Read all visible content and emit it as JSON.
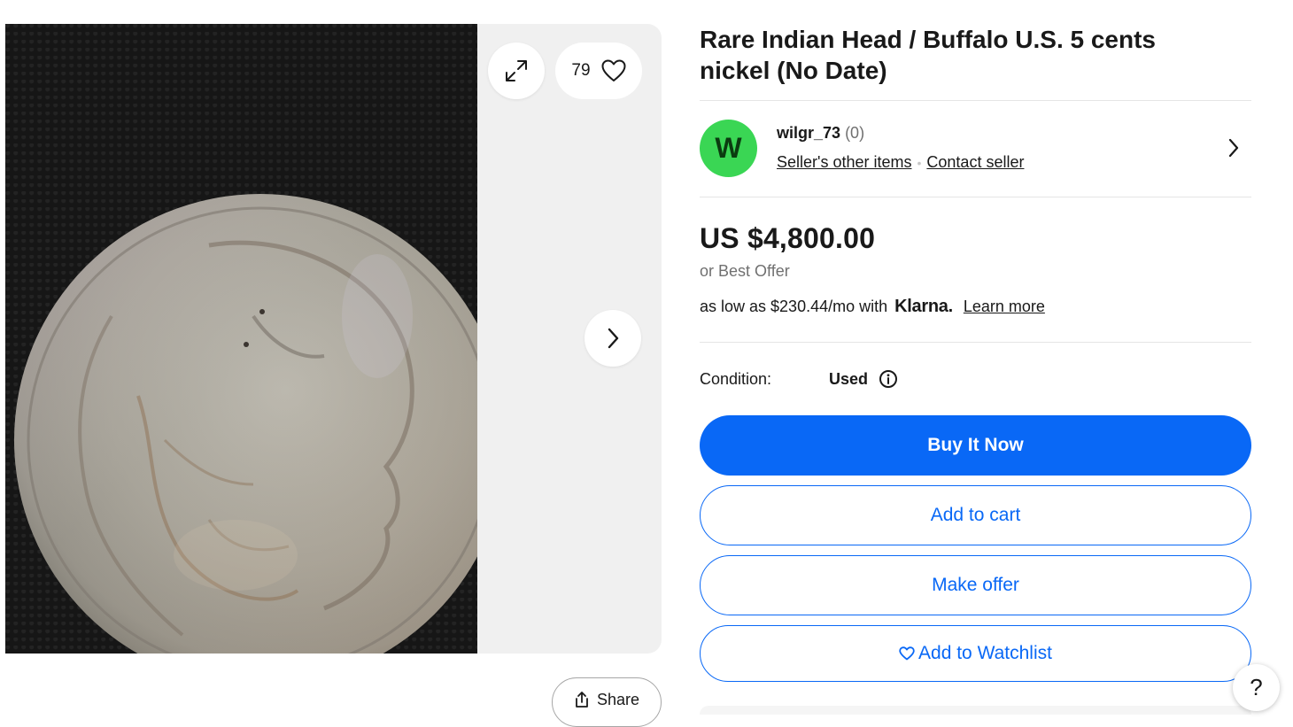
{
  "gallery": {
    "watch_count": "79",
    "share_label": "Share",
    "image_alt": "Buffalo nickel coin photo"
  },
  "listing": {
    "title": "Rare Indian Head / Buffalo U.S. 5 cents nickel (No Date)"
  },
  "seller": {
    "avatar_letter": "W",
    "name": "wilgr_73",
    "score": "(0)",
    "other_items_label": "Seller's other items",
    "contact_label": "Contact seller"
  },
  "pricing": {
    "price": "US $4,800.00",
    "best_offer": "or Best Offer",
    "financing_text": "as low as $230.44/mo with",
    "financing_brand": "Klarna.",
    "learn_more": "Learn more"
  },
  "condition": {
    "label": "Condition:",
    "value": "Used"
  },
  "actions": {
    "buy_now": "Buy It Now",
    "add_to_cart": "Add to cart",
    "make_offer": "Make offer",
    "add_to_watchlist": "Add to Watchlist"
  },
  "help": {
    "label": "?"
  },
  "colors": {
    "primary_blue": "#0968f6",
    "avatar_green": "#3ad654",
    "text": "#191919",
    "muted": "#707070"
  }
}
